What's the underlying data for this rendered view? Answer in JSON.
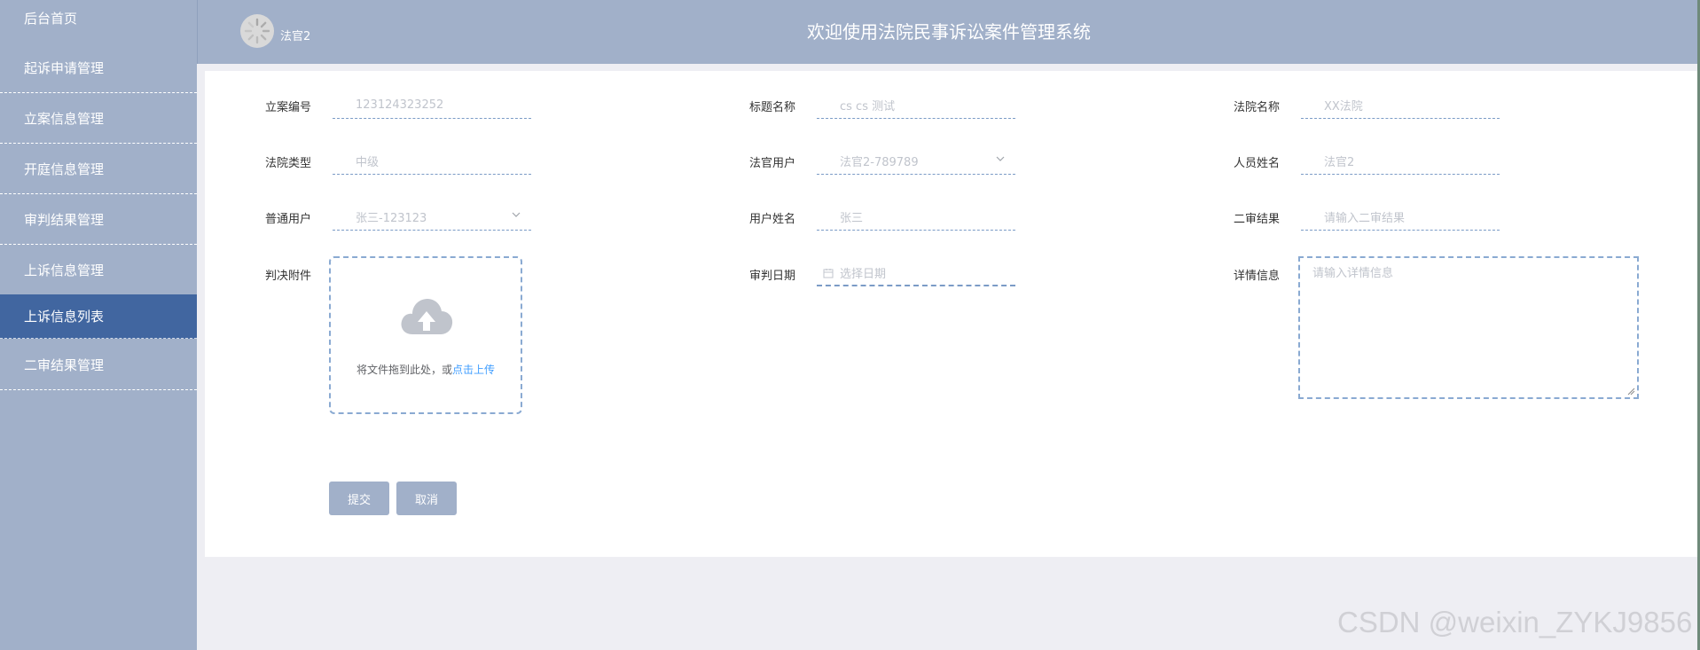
{
  "header": {
    "username": "法官2",
    "title": "欢迎使用法院民事诉讼案件管理系统"
  },
  "sidebar": {
    "items": [
      {
        "label": "后台首页"
      },
      {
        "label": "起诉申请管理"
      },
      {
        "label": "立案信息管理"
      },
      {
        "label": "开庭信息管理"
      },
      {
        "label": "审判结果管理"
      },
      {
        "label": "上诉信息管理"
      },
      {
        "label": "上诉信息列表",
        "active": true
      },
      {
        "label": "二审结果管理"
      }
    ]
  },
  "form": {
    "case_no": {
      "label": "立案编号",
      "value": "123124323252"
    },
    "title_name": {
      "label": "标题名称",
      "value": "cs cs 测试"
    },
    "court_name": {
      "label": "法院名称",
      "value": "XX法院"
    },
    "court_type": {
      "label": "法院类型",
      "value": "中级"
    },
    "judge_user": {
      "label": "法官用户",
      "value": "法官2-789789"
    },
    "person_name": {
      "label": "人员姓名",
      "value": "法官2"
    },
    "normal_user": {
      "label": "普通用户",
      "value": "张三-123123"
    },
    "user_name": {
      "label": "用户姓名",
      "value": "张三"
    },
    "second_result": {
      "label": "二审结果",
      "placeholder": "请输入二审结果"
    },
    "attachment": {
      "label": "判决附件",
      "hint": "将文件拖到此处，或",
      "link": "点击上传"
    },
    "trial_date": {
      "label": "审判日期",
      "placeholder": "选择日期"
    },
    "details": {
      "label": "详情信息",
      "placeholder": "请输入详情信息"
    },
    "submit_label": "提交",
    "cancel_label": "取消"
  },
  "watermark": "CSDN @weixin_ZYKJ9856",
  "colors": {
    "sidebar_bg": "#a1b0c9",
    "sidebar_active": "#4166a0",
    "accent_link": "#409eff"
  }
}
